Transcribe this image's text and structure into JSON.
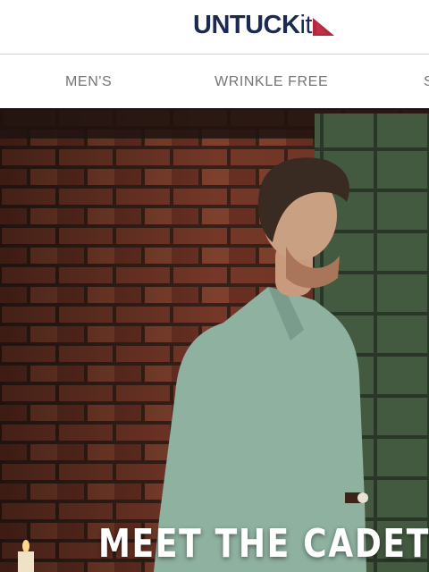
{
  "brand": {
    "logo_upper": "UNTUCK",
    "logo_lower": "it",
    "logo_flag_color": "#b5253b",
    "logo_text_color": "#1c2a52"
  },
  "nav": {
    "items": [
      {
        "label": "MEN'S"
      },
      {
        "label": "WRINKLE FREE"
      },
      {
        "label": "S"
      }
    ]
  },
  "hero": {
    "headline": "MEET THE CADETTO"
  }
}
